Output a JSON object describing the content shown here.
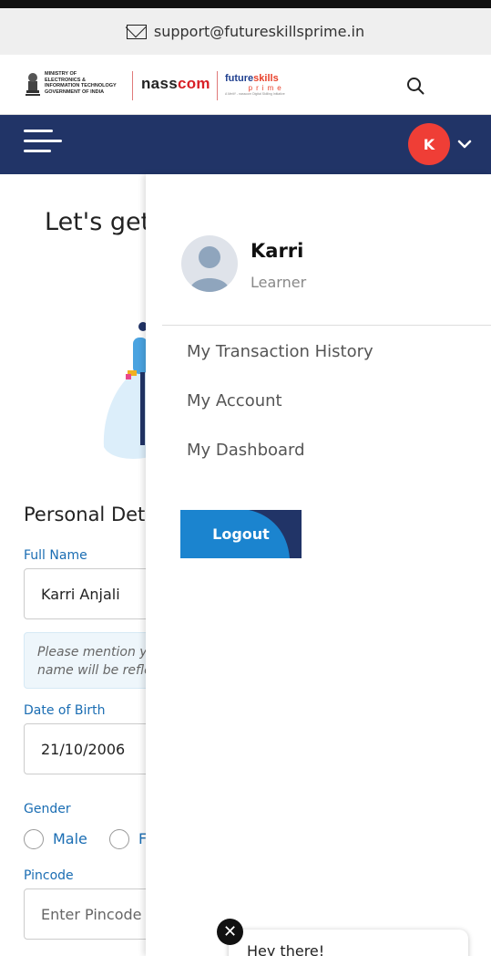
{
  "support": {
    "email": "support@futureskillsprime.in"
  },
  "logos": {
    "meity_lines": [
      "MINISTRY OF",
      "ELECTRONICS &",
      "INFORMATION TECHNOLOGY",
      "GOVERNMENT OF INDIA"
    ],
    "nasscom_prefix": "nass",
    "nasscom_suffix": "com",
    "futureskills_a": "future",
    "futureskills_b": "skills",
    "prime": "prime",
    "tagline": "A MeitY - nasscom Digital Skilling Initiative"
  },
  "navbar": {
    "avatar_initial": "K",
    "accent": "#ef3e36",
    "bg": "#213467"
  },
  "background_page": {
    "title": "Let's get",
    "section_title": "Personal Deta",
    "full_name_label": "Full Name",
    "full_name_value": "Karri Anjali",
    "name_note": "Please mention yo name will be refle",
    "name_note_line1": "Please mention yo",
    "name_note_line2": "name will be refle",
    "dob_label": "Date of Birth",
    "dob_value": "21/10/2006",
    "gender_label": "Gender",
    "gender_male": "Male",
    "gender_female_partial": "F",
    "pincode_label": "Pincode",
    "pincode_placeholder": "Enter Pincode"
  },
  "user_menu": {
    "name": "Karri",
    "role": "Learner",
    "items": [
      "My Transaction History",
      "My Account",
      "My Dashboard"
    ],
    "logout_label": "Logout"
  },
  "chat": {
    "close_glyph": "✕",
    "greeting": "Hey there!"
  }
}
